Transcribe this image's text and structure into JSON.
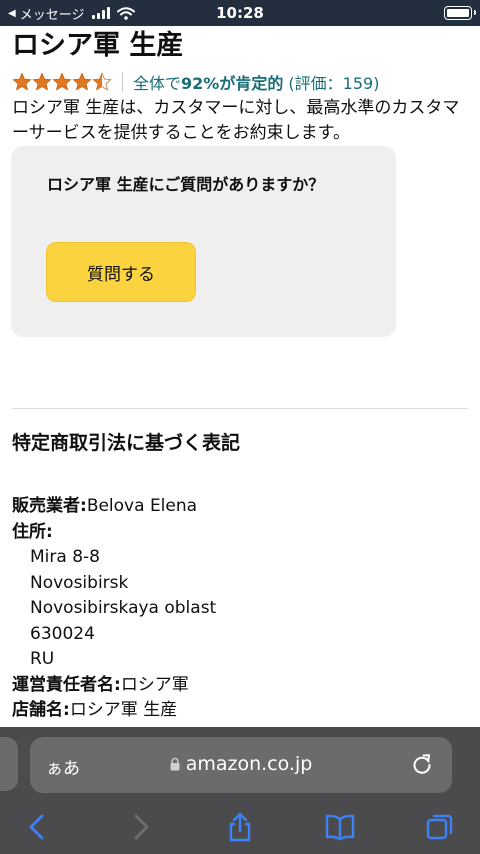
{
  "status_bar": {
    "carrier": "メッセージ",
    "time": "10:28",
    "back_glyph": "◀",
    "icons": [
      "signal-icon",
      "wifi-icon",
      "battery-icon"
    ]
  },
  "product": {
    "title": "ロシア軍 生産",
    "rating_stars": 4.5,
    "rating_prefix": "全体で",
    "rating_percent": "92%が肯定的",
    "rating_count_text": "(評価：159)",
    "description": "ロシア軍 生産は、カスタマーに対し、最高水準のカスタマーサービスを提供することをお約束します。"
  },
  "qa_card": {
    "heading": "ロシア軍 生産にご質問がありますか？",
    "button_label": "質問する"
  },
  "legal": {
    "heading": "特定商取引法に基づく表記",
    "seller_label": "販売業者:",
    "seller_value": "Belova Elena",
    "address_label": "住所:",
    "address_lines": [
      "Mira 8-8",
      "Novosibirsk",
      "Novosibirskaya oblast",
      "630024",
      "RU"
    ],
    "manager_label": "運営責任者名:",
    "manager_value": "ロシア軍",
    "store_label": "店舗名:",
    "store_value": "ロシア軍 生産"
  },
  "browser": {
    "aa_label": "ぁあ",
    "url": "amazon.co.jp",
    "toolbar_icons": [
      "back-icon",
      "forward-icon",
      "share-icon",
      "bookmarks-icon",
      "tabs-icon"
    ]
  },
  "colors": {
    "status_bar_bg": "#232f3e",
    "link_teal": "#1a6e78",
    "star_orange": "#de7921",
    "button_yellow": "#fad33f",
    "card_gray": "#efefef",
    "browser_bar_bg": "#4b4b4d",
    "toolbar_blue": "#3b82f6"
  }
}
